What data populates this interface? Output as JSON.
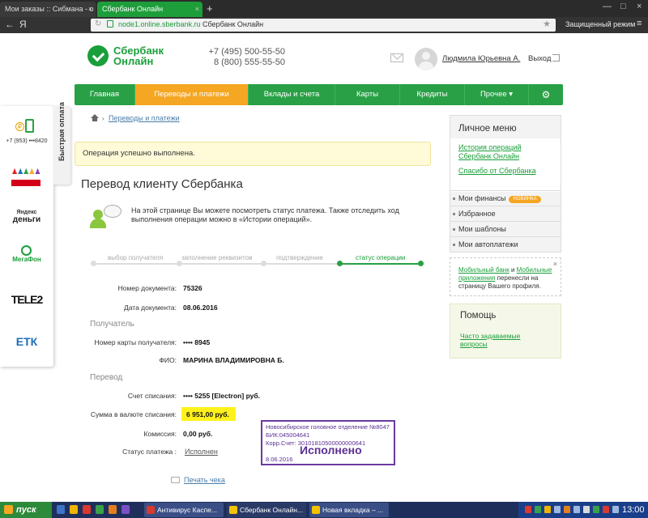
{
  "browser": {
    "tab_inactive": "Мои заказы :: Сибмана - о",
    "tab_active": "Сбербанк Онлайн",
    "tab_close": "×",
    "tab_add": "+",
    "win_min": "—",
    "win_max": "□",
    "win_close": "×",
    "back": "←",
    "yandex": "Я",
    "url": "node1.online.sberbank.ru",
    "page_title": "Сбербанк Онлайн",
    "secure_mode": "Защищенный режим",
    "menu": "≡"
  },
  "header": {
    "logo_line1": "Сбербанк",
    "logo_line2": "Онлайн",
    "phone1": "+7 (495) 500-55-50",
    "phone2": "8 (800) 555-55-50",
    "user_name": "Людмила Юрьевна А.",
    "logout": "Выход"
  },
  "nav": {
    "items": [
      "Главная",
      "Переводы и платежи",
      "Вклады и счета",
      "Карты",
      "Кредиты",
      "Прочее ▾"
    ],
    "gear": "⚙"
  },
  "side_widget": {
    "tab_label": "Быстрая оплата",
    "phone_number": "+7 (953) •••8420",
    "coin": "₽",
    "yandex_top": "Яндекс",
    "yandex_bottom": "деньги",
    "megafon": "МегаФон",
    "tele2": "TELE2",
    "etk": "ЕТК"
  },
  "breadcrumb": {
    "arrow": "›",
    "text": "Переводы и платежи"
  },
  "alert": "Операция успешно выполнена.",
  "title": "Перевод клиенту Сбербанка",
  "info_text": "На этой странице Вы можете посмотреть статус платежа. Также отследить ход выполнения операции можно в «Истории операций».",
  "steps": [
    "выбор получателя",
    "заполнение реквизитов",
    "подтверждение",
    "статус операции"
  ],
  "details": {
    "doc_number_label": "Номер документа:",
    "doc_number": "75326",
    "doc_date_label": "Дата документа:",
    "doc_date": "08.06.2016",
    "recipient_section": "Получатель",
    "card_label": "Номер карты получателя:",
    "card": "•••• 8945",
    "fio_label": "ФИО:",
    "fio": "МАРИНА ВЛАДИМИРОВНА Б.",
    "transfer_section": "Перевод",
    "account_label": "Счет списания:",
    "account": "•••• 5255  [Electron]  руб.",
    "sum_label": "Сумма в валюте списания:",
    "sum": "6 951,00  руб.",
    "commission_label": "Комиссия:",
    "commission": "0,00 руб.",
    "status_label": "Статус платежа :",
    "status": "Исполнен",
    "print": "Печать чека"
  },
  "stamp": {
    "line1": "Новосибирское головное отделение №8047",
    "line2": "БИК:045004641",
    "line3": "Корр.Счет: 30101810500000000641",
    "big": "Исполнено",
    "date": "8.06.2016"
  },
  "right_panel": {
    "menu_title": "Личное меню",
    "link1": "История операций Сбербанк Онлайн",
    "link2": "Спасибо от Сбербанка",
    "row1": "Мои финансы",
    "row1_badge": "НОВИНКА",
    "row2": "Избранное",
    "row3": "Мои шаблоны",
    "row4": "Мои автоплатежи",
    "note_link1": "Мобильный банк",
    "note_and": " и ",
    "note_link2": "Мобильные приложения",
    "note_rest": " перенесли на страницу Вашего профиля.",
    "note_close": "×",
    "help_title": "Помощь",
    "help_link": "Часто задаваемые вопросы"
  },
  "taskbar": {
    "start": "пуск",
    "task1": "Антивирус Каспе...",
    "task2": "Сбербанк Онлайн...",
    "task3": "Новая вкладка – ...",
    "clock": "13:00"
  },
  "colors": {
    "sber_green": "#29a046",
    "nav_active": "#f5a623",
    "stamp_purple": "#5b2f91",
    "highlight": "#fff21c"
  }
}
